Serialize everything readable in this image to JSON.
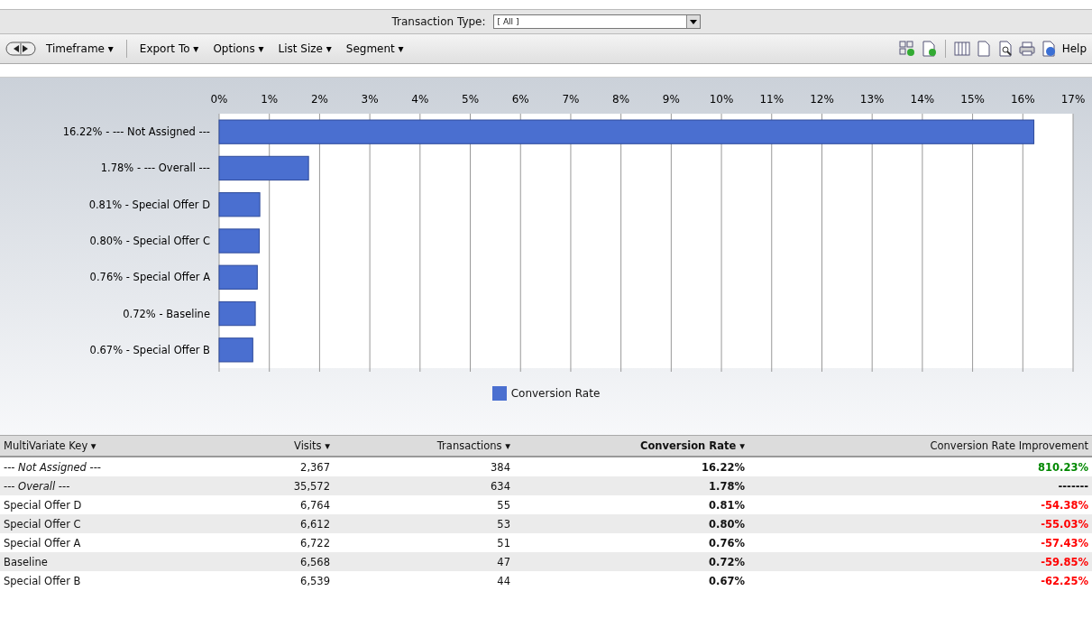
{
  "filter": {
    "label": "Transaction Type:",
    "value": "[ All ]"
  },
  "toolbar": {
    "menus": [
      {
        "label": "Timeframe ▾"
      },
      {
        "label": "Export To ▾"
      },
      {
        "label": "Options ▾"
      },
      {
        "label": "List Size ▾"
      },
      {
        "label": "Segment ▾"
      }
    ],
    "help": "Help"
  },
  "chart": {
    "chart_data": {
      "type": "bar",
      "orientation": "horizontal",
      "grid": true,
      "categories": [
        "16.22% - --- Not Assigned ---",
        "1.78% - --- Overall ---",
        "0.81% - Special Offer D",
        "0.80% - Special Offer C",
        "0.76% - Special Offer A",
        "0.72% - Baseline",
        "0.67% - Special Offer B"
      ],
      "series": [
        {
          "name": "Conversion Rate",
          "color": "#4a6fd0",
          "values": [
            16.22,
            1.78,
            0.81,
            0.8,
            0.76,
            0.72,
            0.67
          ]
        }
      ],
      "xlim": [
        0,
        17
      ],
      "xticks": [
        {
          "value": 0,
          "label": "0%"
        },
        {
          "value": 1,
          "label": "1%"
        },
        {
          "value": 2,
          "label": "2%"
        },
        {
          "value": 3,
          "label": "3%"
        },
        {
          "value": 4,
          "label": "4%"
        },
        {
          "value": 5,
          "label": "5%"
        },
        {
          "value": 6,
          "label": "6%"
        },
        {
          "value": 7,
          "label": "7%"
        },
        {
          "value": 8,
          "label": "8%"
        },
        {
          "value": 9,
          "label": "9%"
        },
        {
          "value": 10,
          "label": "10%"
        },
        {
          "value": 11,
          "label": "11%"
        },
        {
          "value": 12,
          "label": "12%"
        },
        {
          "value": 13,
          "label": "13%"
        },
        {
          "value": 14,
          "label": "14%"
        },
        {
          "value": 15,
          "label": "15%"
        },
        {
          "value": 16,
          "label": "16%"
        },
        {
          "value": 17,
          "label": "17%"
        }
      ]
    }
  },
  "table": {
    "columns": [
      {
        "label": "MultiVariate Key ▾",
        "selected": false
      },
      {
        "label": "Visits ▾",
        "selected": false
      },
      {
        "label": "Transactions ▾",
        "selected": false
      },
      {
        "label": "Conversion Rate ▾",
        "selected": true
      },
      {
        "label": "Conversion Rate Improvement",
        "selected": false
      }
    ],
    "rows": [
      {
        "kind": "aggregate",
        "cells": [
          "--- Not Assigned ---",
          "2,367",
          "384",
          "16.22%",
          "810.23%"
        ],
        "color": "#008800"
      },
      {
        "kind": "aggregate",
        "cells": [
          "--- Overall ---",
          "35,572",
          "634",
          "1.78%",
          "-------"
        ],
        "color": "#111111"
      },
      {
        "kind": "item",
        "cells": [
          "Special Offer D",
          "6,764",
          "55",
          "0.81%",
          "-54.38%"
        ],
        "color": "#ff0000"
      },
      {
        "kind": "item",
        "cells": [
          "Special Offer C",
          "6,612",
          "53",
          "0.80%",
          "-55.03%"
        ],
        "color": "#ff0000"
      },
      {
        "kind": "item",
        "cells": [
          "Special Offer A",
          "6,722",
          "51",
          "0.76%",
          "-57.43%"
        ],
        "color": "#ff0000"
      },
      {
        "kind": "item",
        "cells": [
          "Baseline",
          "6,568",
          "47",
          "0.72%",
          "-59.85%"
        ],
        "color": "#ff0000"
      },
      {
        "kind": "item",
        "cells": [
          "Special Offer B",
          "6,539",
          "44",
          "0.67%",
          "-62.25%"
        ],
        "color": "#ff0000"
      }
    ]
  }
}
